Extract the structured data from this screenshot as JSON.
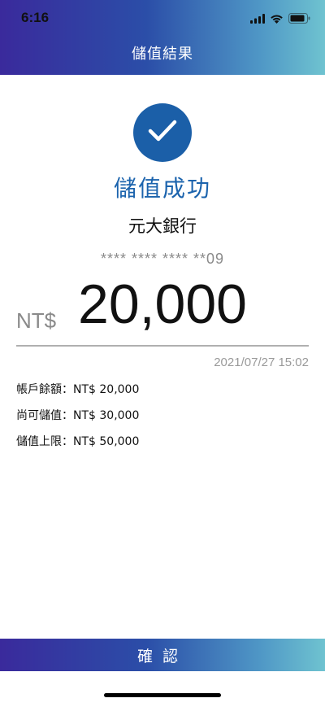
{
  "status_bar": {
    "time": "6:16",
    "icons": [
      "signal-icon",
      "wifi-icon",
      "battery-icon"
    ]
  },
  "header": {
    "title": "儲值結果"
  },
  "result": {
    "icon": "check-icon",
    "title": "儲值成功",
    "bank_name": "元大銀行",
    "card_number": "**** **** **** **09",
    "currency": "NT$",
    "amount": "20,000",
    "timestamp": "2021/07/27 15:02"
  },
  "details": [
    {
      "label": "帳戶餘額：",
      "value": "NT$ 20,000"
    },
    {
      "label": "尚可儲值：",
      "value": "NT$ 30,000"
    },
    {
      "label": "儲值上限：",
      "value": "NT$ 50,000"
    }
  ],
  "footer": {
    "confirm_label": "確認"
  },
  "colors": {
    "accent": "#1b5fa8",
    "gradient_start": "#3a2a9c",
    "gradient_end": "#6fc3d0",
    "muted_text": "#8a8a8a"
  }
}
